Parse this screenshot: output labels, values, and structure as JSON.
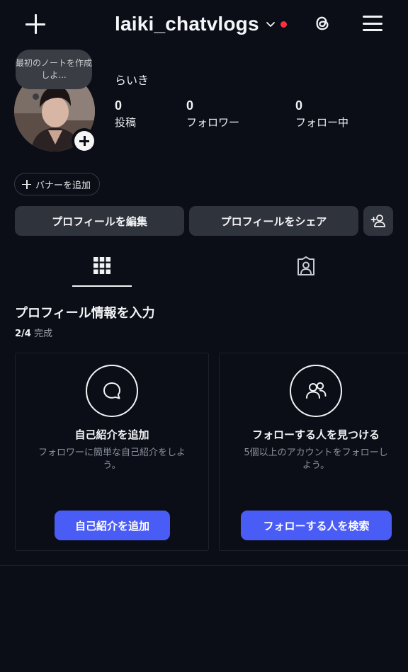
{
  "header": {
    "username": "laiki_chatvlogs"
  },
  "profile": {
    "note_text": "最初のノートを作成しよ...",
    "display_name": "らいき",
    "stats": [
      {
        "value": "0",
        "label": "投稿"
      },
      {
        "value": "0",
        "label": "フォロワー"
      },
      {
        "value": "0",
        "label": "フォロー中"
      }
    ],
    "add_banner_label": "バナーを追加",
    "edit_profile_label": "プロフィールを編集",
    "share_profile_label": "プロフィールをシェア"
  },
  "tabs": [
    {
      "icon": "grid-icon",
      "active": true
    },
    {
      "icon": "tagged-person-icon",
      "active": false
    }
  ],
  "completion": {
    "title": "プロフィール情報を入力",
    "progress_done": "2/4",
    "progress_label": "完成",
    "cards": [
      {
        "icon": "speech-bubble-icon",
        "title": "自己紹介を追加",
        "description": "フォロワーに簡単な自己紹介をしよう。",
        "button": "自己紹介を追加"
      },
      {
        "icon": "people-icon",
        "title": "フォローする人を見つける",
        "description": "5個以上のアカウントをフォローしよう。",
        "button": "フォローする人を検索"
      }
    ]
  },
  "colors": {
    "background": "#0b0e17",
    "primary_button": "#4a5cf6",
    "secondary_button": "#2f333c",
    "notification_dot": "#ff3040"
  }
}
